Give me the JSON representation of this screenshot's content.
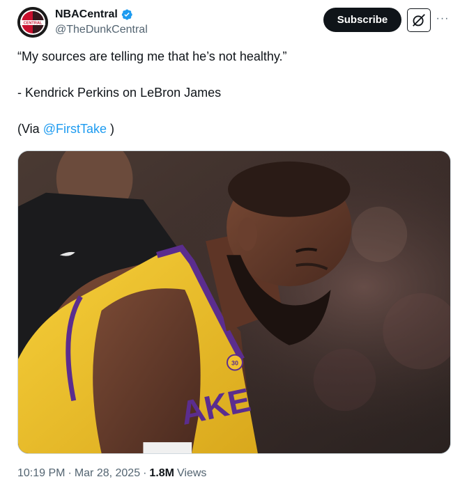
{
  "author": {
    "display_name": "NBACentral",
    "handle": "@TheDunkCentral",
    "avatar_text": "CENTRAL",
    "verified": true
  },
  "actions": {
    "subscribe_label": "Subscribe",
    "more_label": "···"
  },
  "tweet": {
    "quote": "“My sources are telling me that he’s not healthy.”",
    "attribution": "- Kendrick Perkins on LeBron James",
    "via_prefix": "(Via ",
    "via_mention": "@FirstTake",
    "via_suffix": " )"
  },
  "media": {
    "jersey_text": "AKE",
    "jersey_number": "30"
  },
  "meta": {
    "time": "10:19 PM",
    "separator": "·",
    "date": "Mar 28, 2025",
    "views_count": "1.8M",
    "views_label": "Views"
  },
  "colors": {
    "accent": "#1d9bf0",
    "text": "#0f1419",
    "muted": "#536471",
    "lakers_gold": "#f2c230",
    "lakers_purple": "#5b2d8e"
  }
}
